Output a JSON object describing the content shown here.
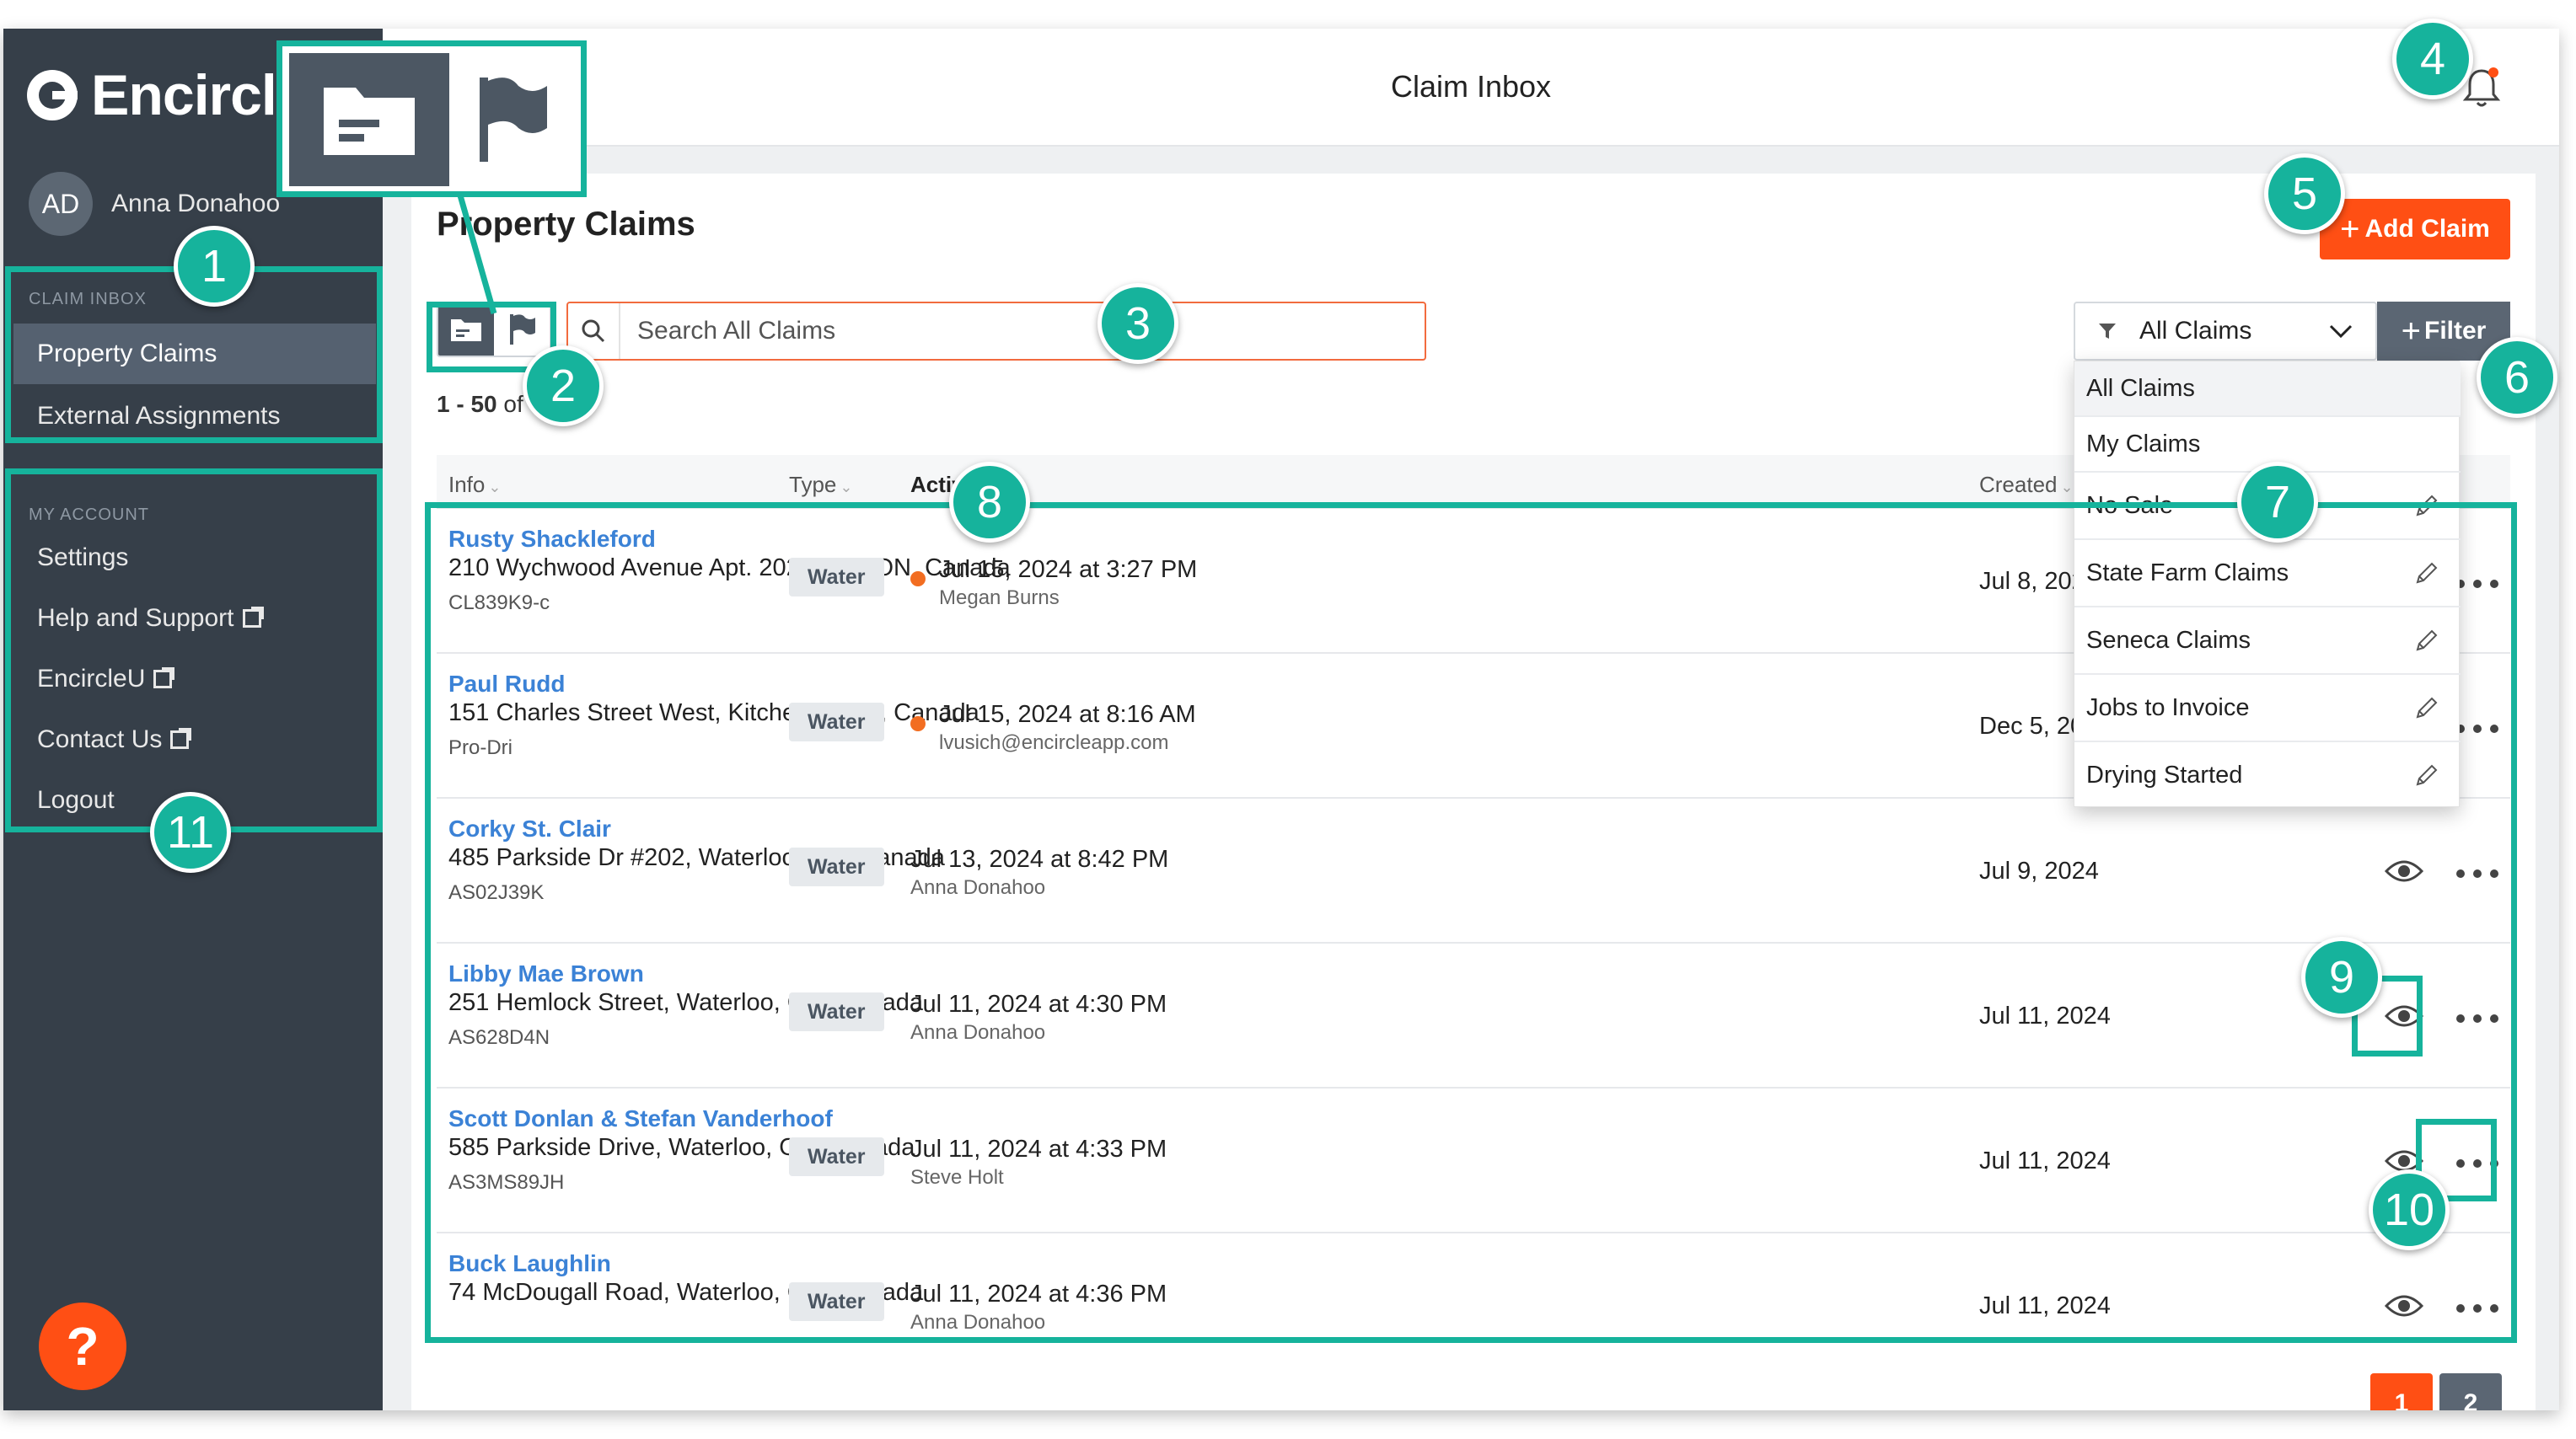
{
  "app": {
    "brand": "Encircle",
    "header_title": "Claim Inbox",
    "accent_color": "#ff4f14",
    "annotation_color": "#16b39c"
  },
  "user": {
    "initials": "AD",
    "name": "Anna Donahoo"
  },
  "sidebar": {
    "claim_inbox_label": "CLAIM INBOX",
    "claim_inbox_items": [
      {
        "label": "Property Claims",
        "active": true
      },
      {
        "label": "External Assignments",
        "active": false
      }
    ],
    "my_account_label": "MY ACCOUNT",
    "account_items": [
      {
        "label": "Settings",
        "external": false
      },
      {
        "label": "Help and Support",
        "external": true
      },
      {
        "label": "EncircleU",
        "external": true
      },
      {
        "label": "Contact Us",
        "external": true
      },
      {
        "label": "Logout",
        "external": false
      }
    ],
    "help_button": "?"
  },
  "main": {
    "page_title": "Property Claims",
    "add_claim_label": "Add Claim",
    "search_placeholder": "Search All Claims",
    "range_bold": "1 - 50",
    "range_rest": " of 9",
    "filter_select_value": "All Claims",
    "filter_button_label": "Filter"
  },
  "table": {
    "columns": [
      "Info",
      "Type",
      "Activity",
      "Created"
    ],
    "rows": [
      {
        "name": "Rusty Shackleford",
        "address": "210 Wychwood Avenue Apt. 202, York, ON, Canada",
        "code": "CL839K9-c",
        "type": "Water",
        "activity_date": "Jul 15, 2024 at 3:27 PM",
        "activity_user": "Megan Burns",
        "new_activity": true,
        "created": "Jul 8, 202"
      },
      {
        "name": "Paul Rudd",
        "address": "151 Charles Street West, Kitchener, ON, Canada",
        "code": "Pro-Dri",
        "type": "Water",
        "activity_date": "Jul 15, 2024 at 8:16 AM",
        "activity_user": "lvusich@encircleapp.com",
        "new_activity": true,
        "created": "Dec 5, 20"
      },
      {
        "name": "Corky St. Clair",
        "address": "485 Parkside Dr #202, Waterloo, ON, Canada",
        "code": "AS02J39K",
        "type": "Water",
        "activity_date": "Jul 13, 2024 at 8:42 PM",
        "activity_user": "Anna Donahoo",
        "new_activity": false,
        "created": "Jul 9, 2024"
      },
      {
        "name": "Libby Mae Brown",
        "address": "251 Hemlock Street, Waterloo, ON, Canada",
        "code": "AS628D4N",
        "type": "Water",
        "activity_date": "Jul 11, 2024 at 4:30 PM",
        "activity_user": "Anna Donahoo",
        "new_activity": false,
        "created": "Jul 11, 2024"
      },
      {
        "name": "Scott Donlan & Stefan Vanderhoof",
        "address": "585 Parkside Drive, Waterloo, ON, Canada",
        "code": "AS3MS89JH",
        "type": "Water",
        "activity_date": "Jul 11, 2024 at 4:33 PM",
        "activity_user": "Steve Holt",
        "new_activity": false,
        "created": "Jul 11, 2024"
      },
      {
        "name": "Buck Laughlin",
        "address": "74 McDougall Road, Waterloo, ON, Canada",
        "code": "",
        "type": "Water",
        "activity_date": "Jul 11, 2024 at 4:36 PM",
        "activity_user": "Anna Donahoo",
        "new_activity": false,
        "created": "Jul 11, 2024"
      }
    ]
  },
  "dropdown": {
    "options": [
      {
        "label": "All Claims",
        "editable": false,
        "selected": true
      },
      {
        "label": "My Claims",
        "editable": false,
        "selected": false
      },
      {
        "label": "No Sale",
        "editable": true,
        "selected": false
      },
      {
        "label": "State Farm Claims",
        "editable": true,
        "selected": false
      },
      {
        "label": "Seneca Claims",
        "editable": true,
        "selected": false
      },
      {
        "label": "Jobs to Invoice",
        "editable": true,
        "selected": false
      },
      {
        "label": "Drying Started",
        "editable": true,
        "selected": false
      }
    ]
  },
  "pagination": {
    "pages": [
      "1",
      "2"
    ],
    "current": "1"
  },
  "annotations": [
    "1",
    "2",
    "3",
    "4",
    "5",
    "6",
    "7",
    "8",
    "9",
    "10",
    "11"
  ]
}
